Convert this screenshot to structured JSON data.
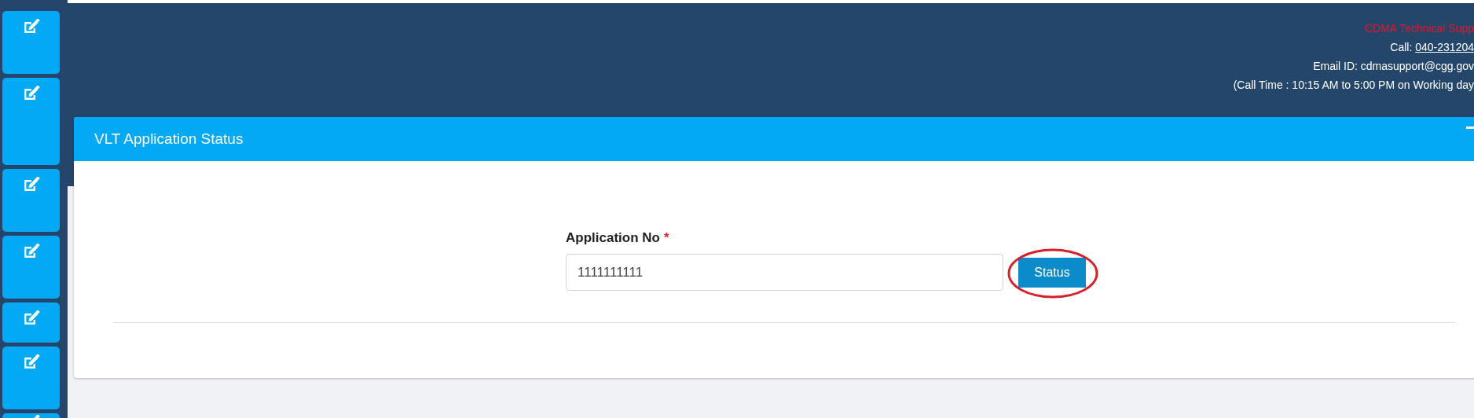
{
  "sidebar": {
    "items": [
      {
        "kind": "normal"
      },
      {
        "kind": "tall"
      },
      {
        "kind": "normal"
      },
      {
        "kind": "normal"
      },
      {
        "kind": "short"
      },
      {
        "kind": "normal"
      },
      {
        "kind": "cut"
      }
    ]
  },
  "header": {
    "support_title": "CDMA Technical Supp",
    "call_label": "Call:",
    "call_number": "040-231204",
    "email": "Email ID: cdmasupport@cgg.gov",
    "call_time": "(Call Time : 10:15 AM to 5:00 PM on Working day"
  },
  "card": {
    "title": "VLT Application Status",
    "field": {
      "label": "Application No",
      "required_mark": "*",
      "value": "1111111111"
    },
    "button": "Status",
    "button_highlighted": true
  }
}
